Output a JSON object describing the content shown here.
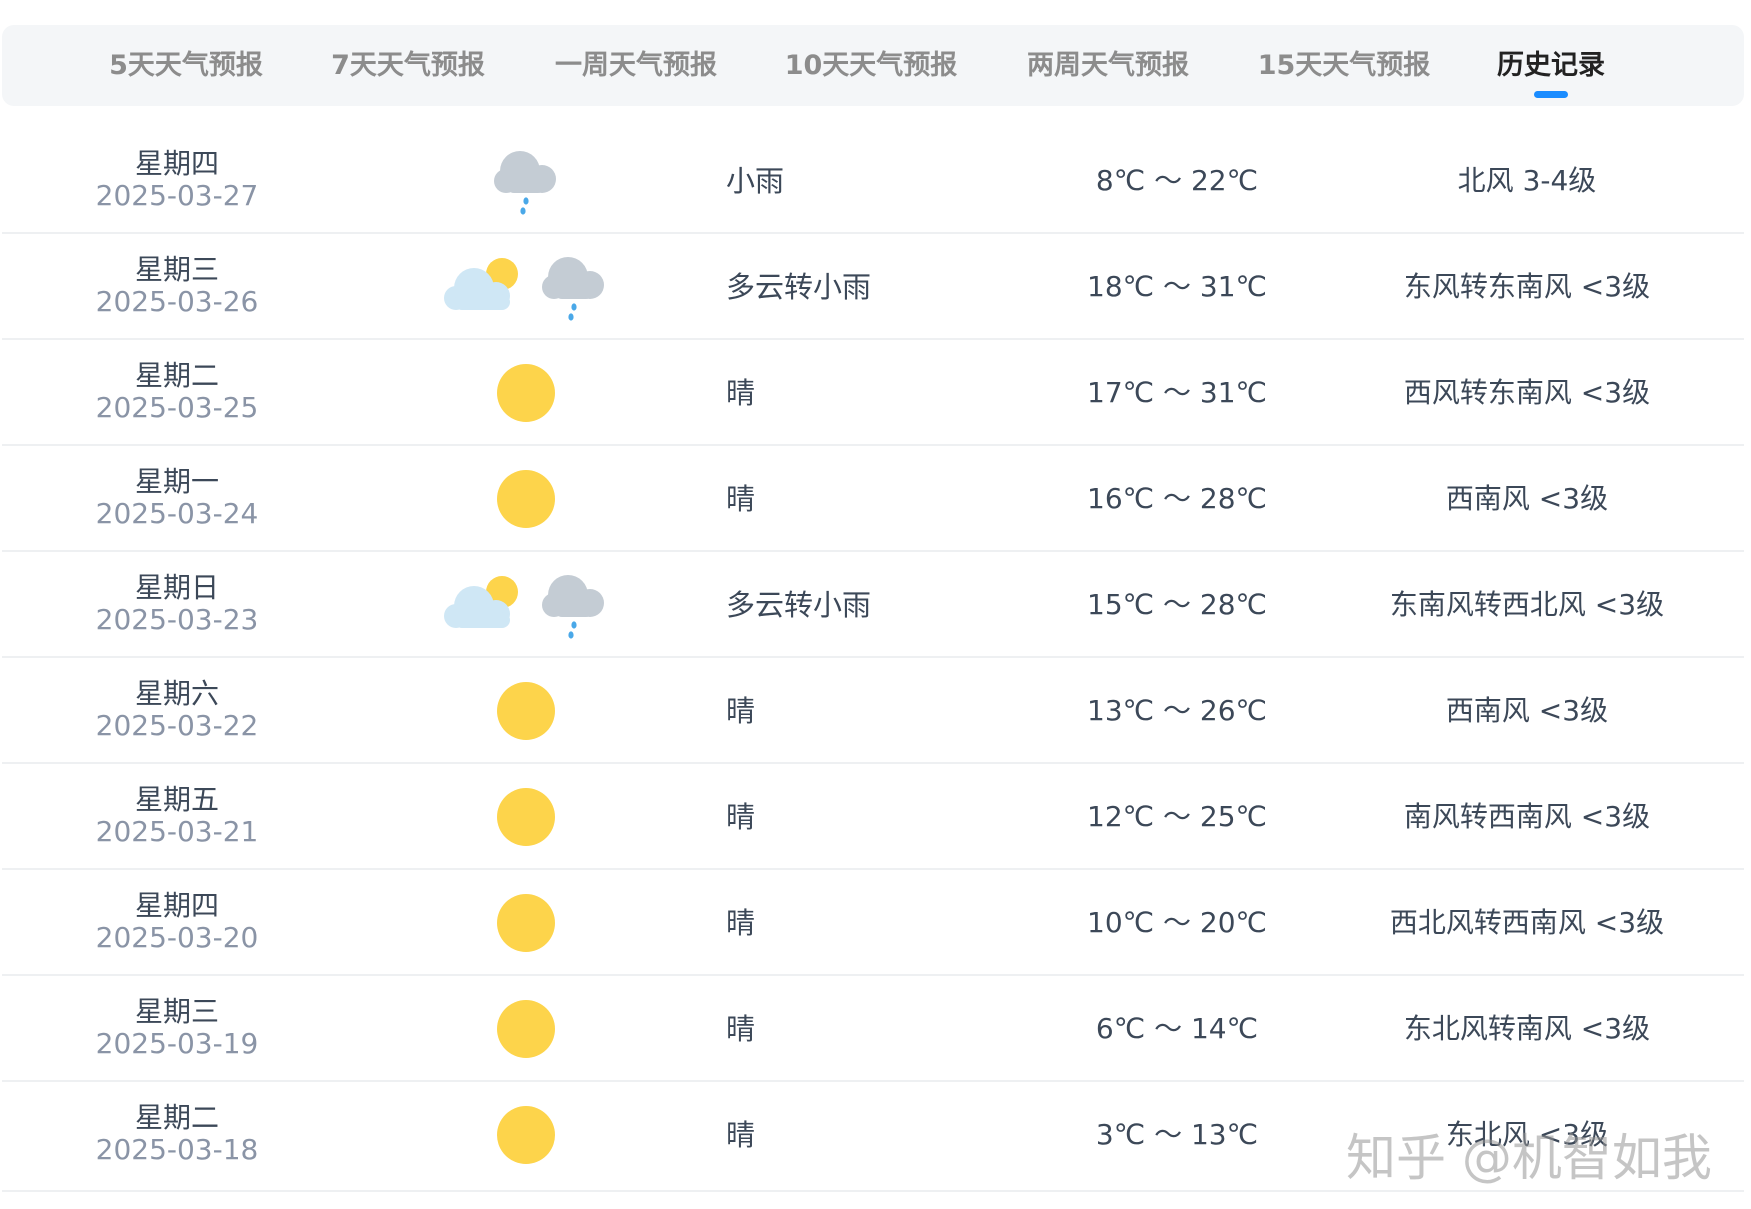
{
  "tabs": [
    {
      "label": "5天天气预报",
      "active": false
    },
    {
      "label": "7天天气预报",
      "active": false
    },
    {
      "label": "一周天气预报",
      "active": false
    },
    {
      "label": "10天天气预报",
      "active": false
    },
    {
      "label": "两周天气预报",
      "active": false
    },
    {
      "label": "15天天气预报",
      "active": false
    },
    {
      "label": "历史记录",
      "active": true
    }
  ],
  "colors": {
    "accent": "#1a8cff",
    "sun": "#fdd44b",
    "cloud_gray": "#c4ccd4",
    "cloud_blue": "#cfe7f5",
    "rain": "#4aa8e8"
  },
  "rows": [
    {
      "weekday": "星期四",
      "date": "2025-03-27",
      "icons": [
        "light-rain-icon"
      ],
      "desc": "小雨",
      "temp": "8℃ ～ 22℃",
      "wind": "北风 3-4级"
    },
    {
      "weekday": "星期三",
      "date": "2025-03-26",
      "icons": [
        "partly-cloudy-icon",
        "light-rain-icon"
      ],
      "desc": "多云转小雨",
      "temp": "18℃ ～ 31℃",
      "wind": "东风转东南风 <3级"
    },
    {
      "weekday": "星期二",
      "date": "2025-03-25",
      "icons": [
        "sunny-icon"
      ],
      "desc": "晴",
      "temp": "17℃ ～ 31℃",
      "wind": "西风转东南风 <3级"
    },
    {
      "weekday": "星期一",
      "date": "2025-03-24",
      "icons": [
        "sunny-icon"
      ],
      "desc": "晴",
      "temp": "16℃ ～ 28℃",
      "wind": "西南风 <3级"
    },
    {
      "weekday": "星期日",
      "date": "2025-03-23",
      "icons": [
        "partly-cloudy-icon",
        "light-rain-icon"
      ],
      "desc": "多云转小雨",
      "temp": "15℃ ～ 28℃",
      "wind": "东南风转西北风 <3级"
    },
    {
      "weekday": "星期六",
      "date": "2025-03-22",
      "icons": [
        "sunny-icon"
      ],
      "desc": "晴",
      "temp": "13℃ ～ 26℃",
      "wind": "西南风 <3级"
    },
    {
      "weekday": "星期五",
      "date": "2025-03-21",
      "icons": [
        "sunny-icon"
      ],
      "desc": "晴",
      "temp": "12℃ ～ 25℃",
      "wind": "南风转西南风 <3级"
    },
    {
      "weekday": "星期四",
      "date": "2025-03-20",
      "icons": [
        "sunny-icon"
      ],
      "desc": "晴",
      "temp": "10℃ ～ 20℃",
      "wind": "西北风转西南风 <3级"
    },
    {
      "weekday": "星期三",
      "date": "2025-03-19",
      "icons": [
        "sunny-icon"
      ],
      "desc": "晴",
      "temp": "6℃ ～ 14℃",
      "wind": "东北风转南风 <3级"
    },
    {
      "weekday": "星期二",
      "date": "2025-03-18",
      "icons": [
        "sunny-icon"
      ],
      "desc": "晴",
      "temp": "3℃ ～ 13℃",
      "wind": "东北风 <3级"
    }
  ],
  "watermark": "知乎 @机智如我"
}
